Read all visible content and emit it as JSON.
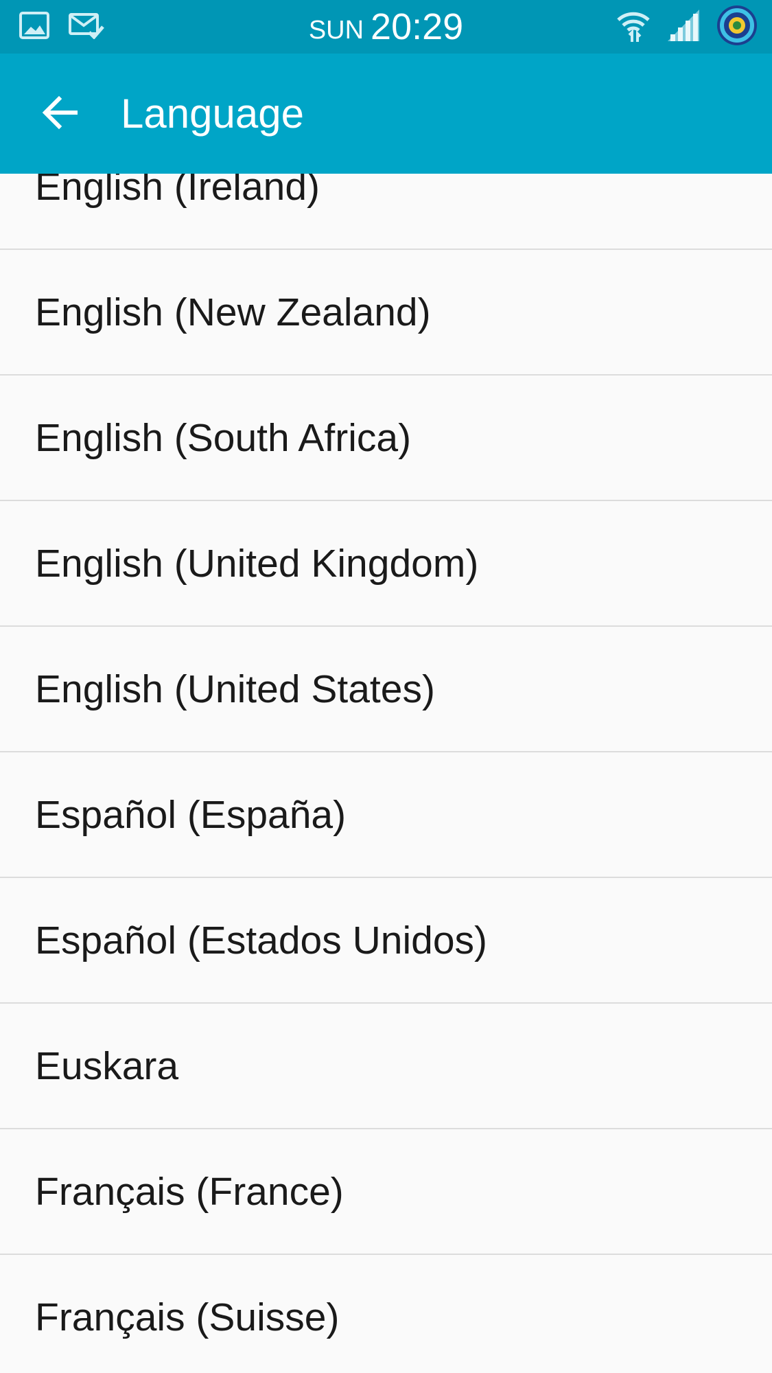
{
  "status_bar": {
    "day": "SUN",
    "time": "20:29",
    "icons": [
      "gallery-icon",
      "mail-check-icon",
      "wifi-icon",
      "signal-icon",
      "app-round-icon"
    ]
  },
  "app_bar": {
    "title": "Language",
    "back_icon": "arrow-left-icon",
    "color": "#00a5c7"
  },
  "languages": [
    "English (Ireland)",
    "English (New Zealand)",
    "English (South Africa)",
    "English (United Kingdom)",
    "English (United States)",
    "Español (España)",
    "Español (Estados Unidos)",
    "Euskara",
    "Français (France)",
    "Français (Suisse)"
  ]
}
